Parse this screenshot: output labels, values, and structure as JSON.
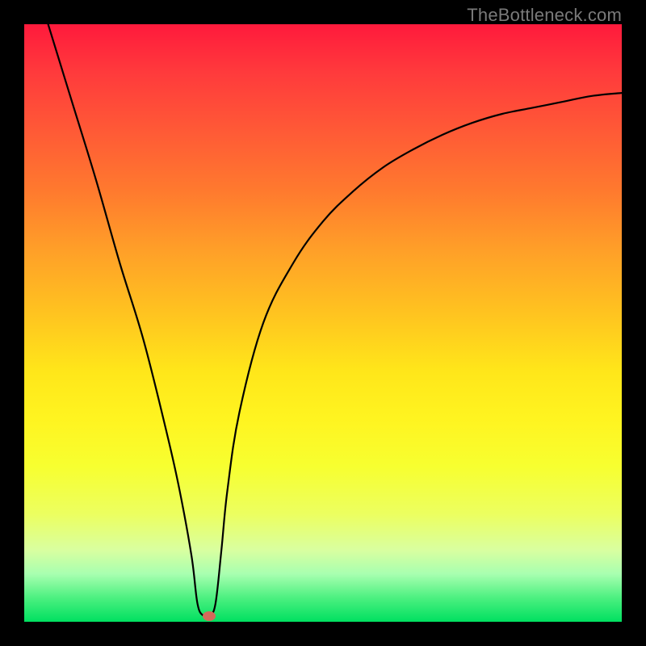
{
  "attribution": "TheBottleneck.com",
  "chart_data": {
    "type": "line",
    "title": "",
    "xlabel": "",
    "ylabel": "",
    "xlim": [
      0,
      100
    ],
    "ylim": [
      0,
      100
    ],
    "grid": false,
    "legend": false,
    "series": [
      {
        "name": "curve",
        "x": [
          4,
          8,
          12,
          16,
          20,
          24,
          26,
          28,
          29,
          30,
          31,
          32,
          33,
          34,
          36,
          40,
          45,
          50,
          55,
          60,
          65,
          70,
          75,
          80,
          85,
          90,
          95,
          100
        ],
        "y": [
          100,
          87,
          74,
          60,
          47,
          31,
          22,
          11,
          3,
          1,
          1,
          3,
          12,
          22,
          35,
          50,
          60,
          67,
          72,
          76,
          79,
          81.5,
          83.5,
          85,
          86,
          87,
          88,
          88.5
        ]
      }
    ],
    "marker": {
      "x": 31,
      "y": 1,
      "color": "#d46a5a"
    },
    "colors": {
      "background_top": "#ff1a3c",
      "background_bottom": "#00e060",
      "frame": "#000000",
      "curve": "#000000",
      "marker": "#d46a5a",
      "attribution_text": "#7a7a7a"
    }
  }
}
